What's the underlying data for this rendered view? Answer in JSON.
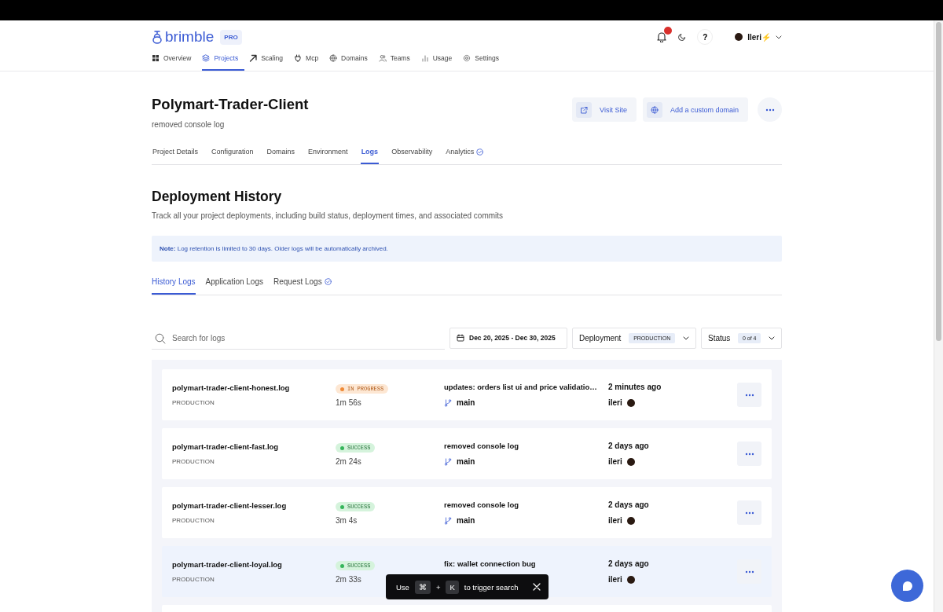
{
  "brand": {
    "name": "brimble",
    "plan": "PRO"
  },
  "header": {
    "help": "?",
    "user": "Ileri⚡"
  },
  "nav": [
    {
      "label": "Overview",
      "selected": false
    },
    {
      "label": "Projects",
      "selected": true
    },
    {
      "label": "Scaling",
      "selected": false
    },
    {
      "label": "Mcp",
      "selected": false
    },
    {
      "label": "Domains",
      "selected": false
    },
    {
      "label": "Teams",
      "selected": false
    },
    {
      "label": "Usage",
      "selected": false
    },
    {
      "label": "Settings",
      "selected": false
    }
  ],
  "project": {
    "title": "Polymart-Trader-Client",
    "subtitle": "removed console log",
    "actions": [
      {
        "label": "Visit Site"
      },
      {
        "label": "Add a custom domain"
      }
    ]
  },
  "tabs": [
    {
      "label": "Project Details",
      "selected": false,
      "check": false
    },
    {
      "label": "Configuration",
      "selected": false,
      "check": false
    },
    {
      "label": "Domains",
      "selected": false,
      "check": false
    },
    {
      "label": "Environment",
      "selected": false,
      "check": false
    },
    {
      "label": "Logs",
      "selected": true,
      "check": false
    },
    {
      "label": "Observability",
      "selected": false,
      "check": false
    },
    {
      "label": "Analytics",
      "selected": false,
      "check": true
    }
  ],
  "section": {
    "title": "Deployment History",
    "description": "Track all your project deployments, including build status, deployment times, and associated commits",
    "note": "**Note:** Log retention is limited to 30 days. Older logs will be automatically archived."
  },
  "log_tabs": [
    {
      "label": "History Logs",
      "selected": true,
      "check": false
    },
    {
      "label": "Application Logs",
      "selected": false,
      "check": false
    },
    {
      "label": "Request Logs",
      "selected": false,
      "check": true
    }
  ],
  "filters": {
    "search": {
      "placeholder": "Search for logs"
    },
    "date_range": "Dec 20, 2025 - Dec 30, 2025",
    "deployment": {
      "label": "Deployment",
      "value": "PRODUCTION"
    },
    "status": {
      "label": "Status",
      "value": "0 of 4"
    }
  },
  "deployments": [
    {
      "file": "polymart-trader-client-honest.log",
      "env": "PRODUCTION",
      "status": {
        "kind": "in_progress",
        "label": "IN PROGRESS"
      },
      "duration": "1m 56s",
      "commit": "updates: orders list ui and price validatio…",
      "branch": "main",
      "time": "2 minutes ago",
      "author": "ileri",
      "selected": false
    },
    {
      "file": "polymart-trader-client-fast.log",
      "env": "PRODUCTION",
      "status": {
        "kind": "success",
        "label": "SUCCESS"
      },
      "duration": "2m 24s",
      "commit": "removed console log",
      "branch": "main",
      "time": "2 days ago",
      "author": "ileri",
      "selected": false
    },
    {
      "file": "polymart-trader-client-lesser.log",
      "env": "PRODUCTION",
      "status": {
        "kind": "success",
        "label": "SUCCESS"
      },
      "duration": "3m 4s",
      "commit": "removed console log",
      "branch": "main",
      "time": "2 days ago",
      "author": "ileri",
      "selected": false
    },
    {
      "file": "polymart-trader-client-loyal.log",
      "env": "PRODUCTION",
      "status": {
        "kind": "success",
        "label": "SUCCESS"
      },
      "duration": "2m 33s",
      "commit": "fix: wallet connection bug",
      "time": "2 days ago",
      "author": "ileri",
      "selected": true
    }
  ],
  "toast": {
    "prefix": "Use",
    "key1": "⌘",
    "plus": "+",
    "key2": "K",
    "suffix": "to trigger search"
  }
}
